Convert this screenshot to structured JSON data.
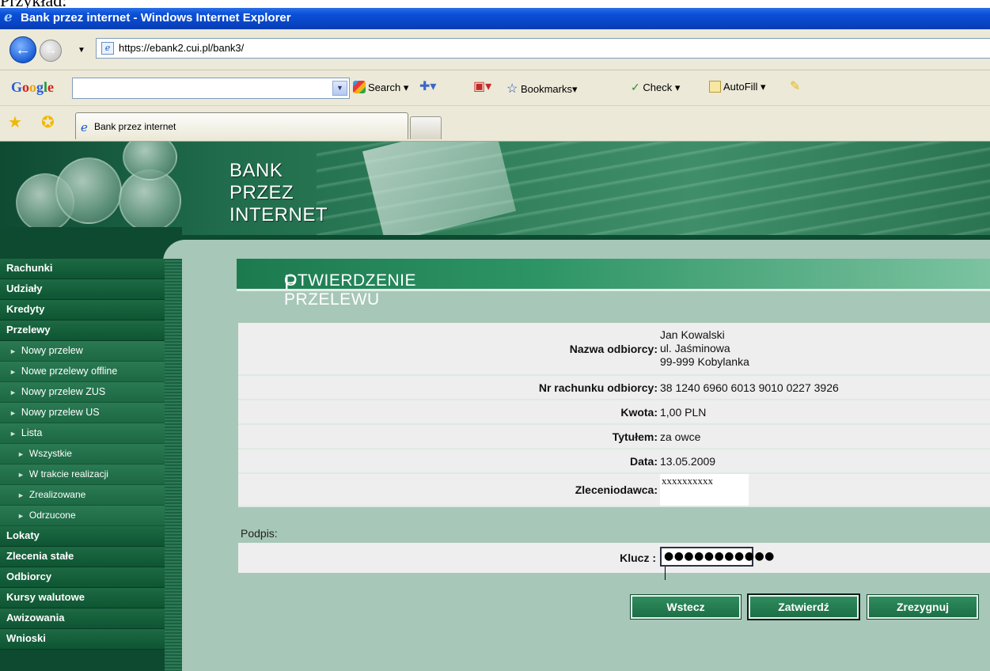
{
  "caption": "Przykład:",
  "window": {
    "title": "Bank przez internet - Windows Internet Explorer"
  },
  "address": {
    "url": "https://ebank2.cui.pl/bank3/"
  },
  "google_toolbar": {
    "logo": "Google",
    "search_value": "",
    "search_label": "Search",
    "bookmarks_label": "Bookmarks",
    "check_label": "Check",
    "autofill_label": "AutoFill"
  },
  "tab": {
    "label": "Bank przez internet"
  },
  "banner": {
    "line1": "BANK",
    "line2": "PRZEZ",
    "line3": "INTERNET"
  },
  "sidebar": {
    "items": [
      {
        "label": "Rachunki"
      },
      {
        "label": "Udziały"
      },
      {
        "label": "Kredyty"
      },
      {
        "label": "Przelewy"
      },
      {
        "label": "Nowy przelew"
      },
      {
        "label": "Nowe przelewy offline"
      },
      {
        "label": "Nowy przelew ZUS"
      },
      {
        "label": "Nowy przelew US"
      },
      {
        "label": "Lista"
      },
      {
        "label": "Wszystkie"
      },
      {
        "label": "W trakcie realizacji"
      },
      {
        "label": "Zrealizowane"
      },
      {
        "label": "Odrzucone"
      },
      {
        "label": "Lokaty"
      },
      {
        "label": "Zlecenia stałe"
      },
      {
        "label": "Odbiorcy"
      },
      {
        "label": "Kursy walutowe"
      },
      {
        "label": "Awizowania"
      },
      {
        "label": "Wnioski"
      }
    ]
  },
  "main": {
    "heading_first": "P",
    "heading_rest": "OTWIERDZENIE PRZELEWU",
    "details": {
      "recipient_label": "Nazwa odbiorcy:",
      "recipient_name": "Jan Kowalski",
      "recipient_street": "ul. Jaśminowa",
      "recipient_city": "99-999 Kobylanka",
      "account_label": "Nr rachunku odbiorcy:",
      "account_value": "38 1240 6960 6013 9010 0227 3926",
      "amount_label": "Kwota:",
      "amount_value": "1,00 PLN",
      "title_label": "Tytułem:",
      "title_value": "za owce",
      "date_label": "Data:",
      "date_value": "13.05.2009",
      "orderer_label": "Zleceniodawca:",
      "orderer_value": "xxxxxxxxxx"
    },
    "signature_label": "Podpis:",
    "key_label": "Klucz :",
    "key_value": "●●●●●●●●●●●",
    "buttons": {
      "back": "Wstecz",
      "confirm": "Zatwierdź",
      "cancel": "Zrezygnuj"
    }
  }
}
